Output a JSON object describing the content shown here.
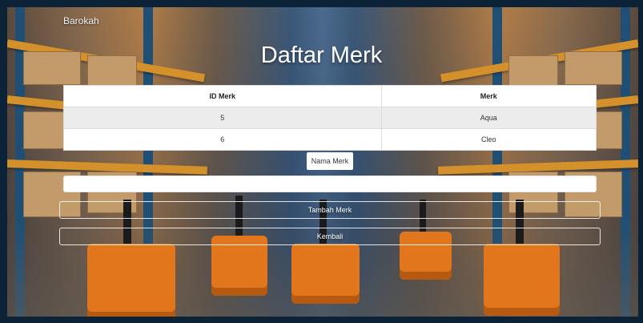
{
  "brand": "Barokah",
  "page_title": "Daftar Merk",
  "table": {
    "headers": [
      "ID Merk",
      "Merk"
    ],
    "rows": [
      [
        "5",
        "Aqua"
      ],
      [
        "6",
        "Cleo"
      ]
    ]
  },
  "form": {
    "label": "Nama Merk",
    "input_value": "",
    "submit_label": "Tambah Merk",
    "back_label": "Kembali"
  },
  "colors": {
    "accent_forklift": "#e2761d",
    "shelf_beam": "#d3902b"
  }
}
